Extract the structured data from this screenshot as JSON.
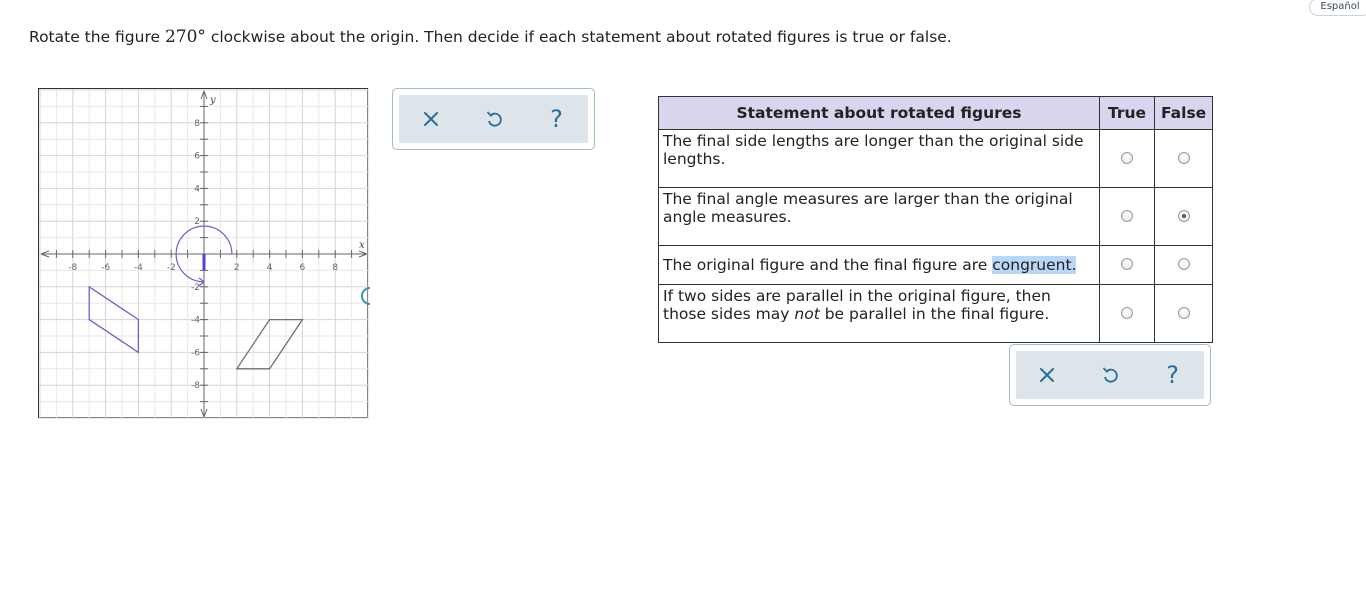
{
  "language_button": "Español",
  "question": {
    "before": "Rotate the figure ",
    "angle": "270°",
    "after": " clockwise about the origin. Then decide if each statement about rotated figures is true or false."
  },
  "graph": {
    "x_axis_label": "x",
    "y_axis_label": "y",
    "x_tick_labels": [
      "-8",
      "-6",
      "-4",
      "-2",
      "2",
      "4",
      "6",
      "8"
    ],
    "y_tick_labels": [
      "8",
      "6",
      "4",
      "2",
      "-2",
      "-4",
      "-6",
      "-8"
    ]
  },
  "tools": {
    "clear_icon": "close-icon",
    "undo_icon": "undo-icon",
    "help_icon": "help-icon",
    "clear_symbol": "×",
    "help_symbol": "?"
  },
  "table": {
    "header_statement": "Statement about rotated figures",
    "header_true": "True",
    "header_false": "False",
    "rows": [
      {
        "text": "The final side lengths are longer than the original side lengths.",
        "selected": "none"
      },
      {
        "text": "The final angle measures are larger than the original angle measures.",
        "selected": "false"
      },
      {
        "text_before": "The original figure and the final figure are ",
        "text_highlight": "congruent.",
        "selected": "none"
      },
      {
        "text_before": "If two sides are parallel in the original figure, then those sides may ",
        "text_emph": "not",
        "text_after": " be parallel in the final figure.",
        "selected": "none"
      }
    ]
  },
  "colors": {
    "header_bg": "#d8d6ef",
    "figure_purple": "#7a5ccf",
    "figure_gray": "#707070",
    "tool_border": "#9fbdcf",
    "highlight": "#b9d8f7"
  }
}
